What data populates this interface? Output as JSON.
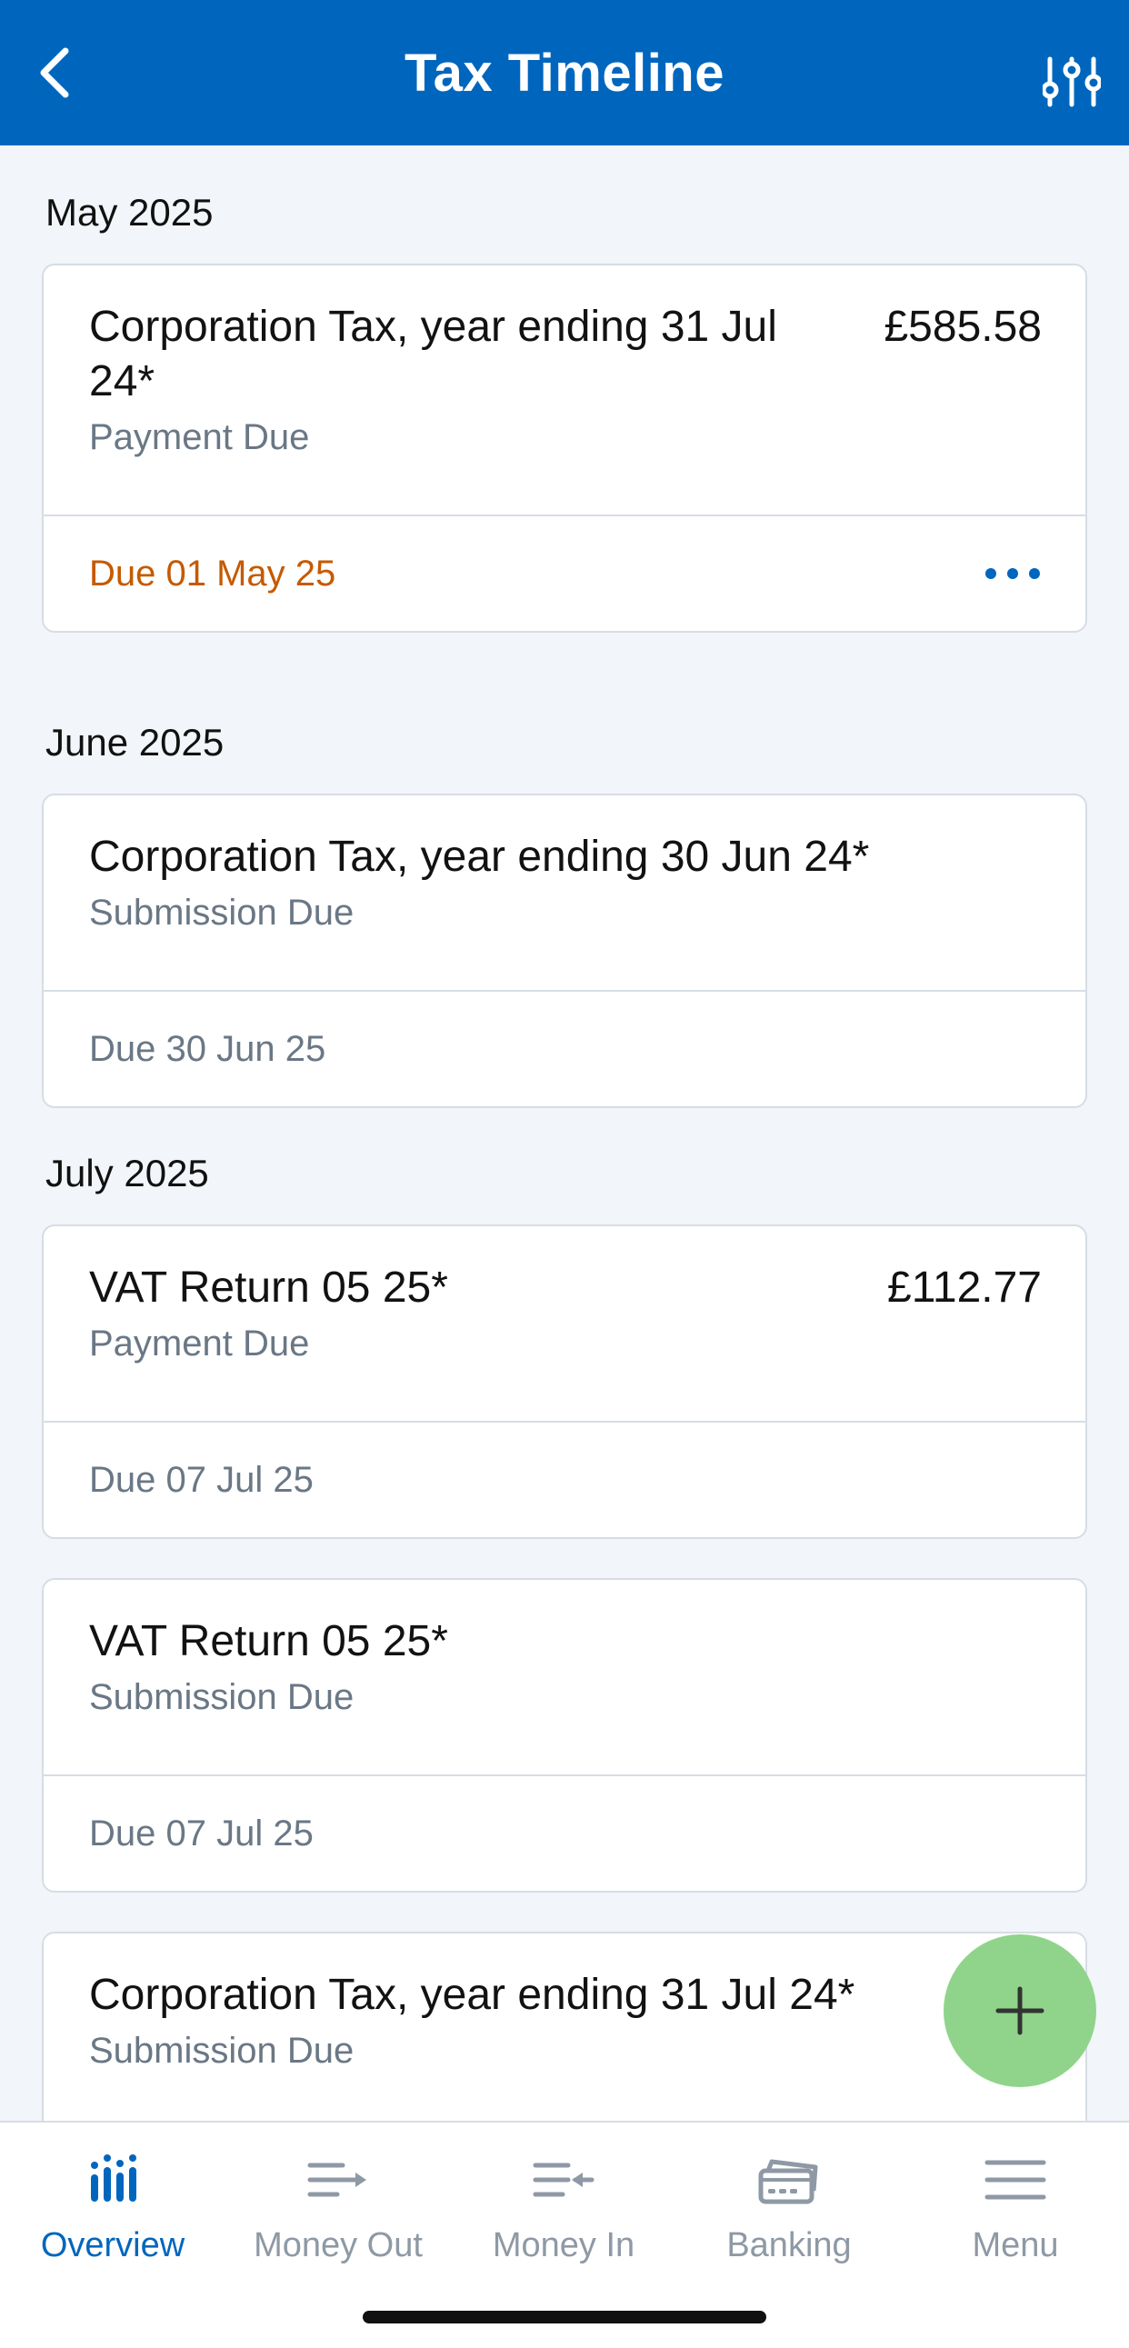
{
  "header": {
    "title": "Tax Timeline",
    "back_icon": "chevron-left-icon",
    "filter_icon": "sliders-icon"
  },
  "sections": [
    {
      "month": "May 2025",
      "items": [
        {
          "name": "Corporation Tax, year ending 31 Jul 24*",
          "type": "Payment Due",
          "amount": "£585.58",
          "due": "Due 01 May 25",
          "overdue": true
        }
      ]
    },
    {
      "month": "June 2025",
      "items": [
        {
          "name": "Corporation Tax, year ending 30 Jun 24*",
          "type": "Submission Due",
          "amount": "",
          "due": "Due 30 Jun 25"
        }
      ]
    },
    {
      "month": "July 2025",
      "items": [
        {
          "name": "VAT Return 05 25*",
          "type": "Payment Due",
          "amount": "£112.77",
          "due": "Due 07 Jul 25"
        },
        {
          "name": "VAT Return 05 25*",
          "type": "Submission Due",
          "amount": "",
          "due": "Due 07 Jul 25"
        },
        {
          "name": "Corporation Tax, year ending 31 Jul 24*",
          "type": "Submission Due",
          "amount": "",
          "due": ""
        }
      ]
    }
  ],
  "fab": {
    "icon": "plus-icon"
  },
  "tabs": [
    {
      "label": "Overview",
      "icon": "bar-chart-icon",
      "active": true
    },
    {
      "label": "Money Out",
      "icon": "money-out-icon",
      "active": false
    },
    {
      "label": "Money In",
      "icon": "money-in-icon",
      "active": false
    },
    {
      "label": "Banking",
      "icon": "banking-cards-icon",
      "active": false
    },
    {
      "label": "Menu",
      "icon": "hamburger-menu-icon",
      "active": false
    }
  ],
  "colors": {
    "brand": "#0066bd",
    "overdue": "#c55a00",
    "fab": "#8fd48a",
    "background": "#f2f5f9"
  }
}
